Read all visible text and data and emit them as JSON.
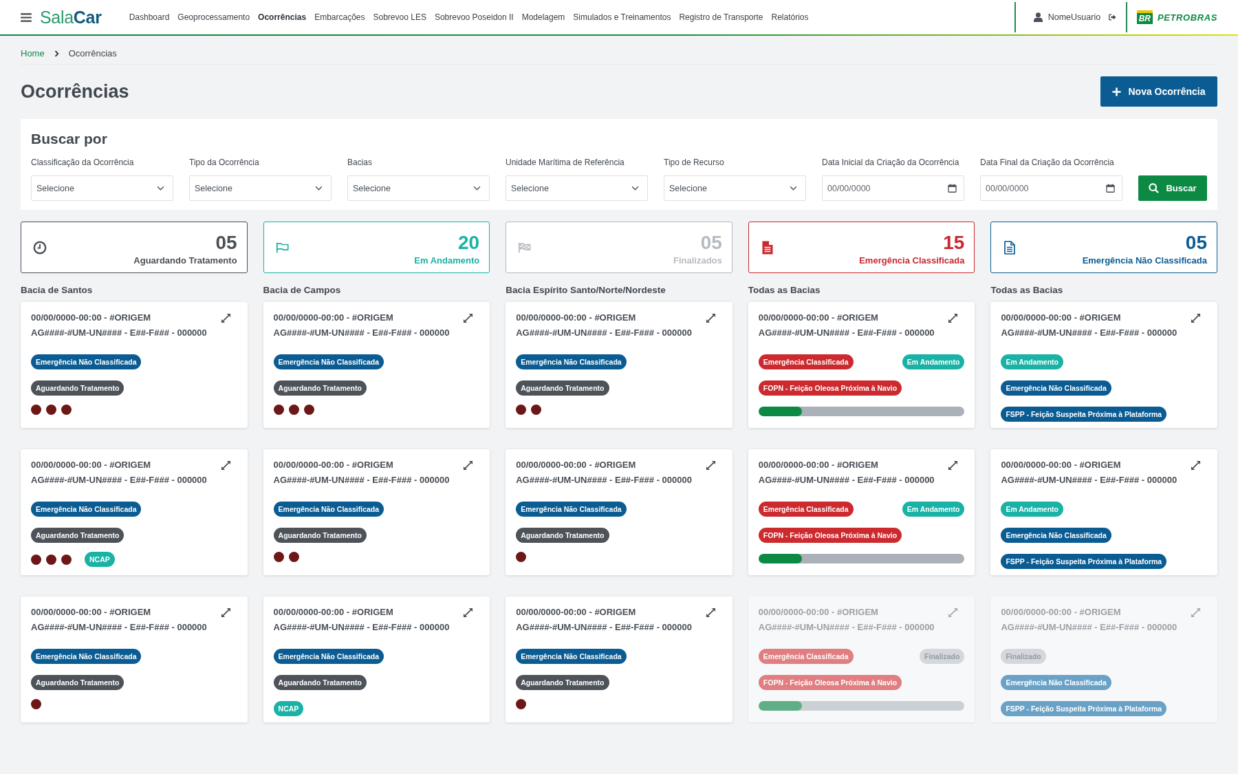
{
  "header": {
    "logo": "Sala**Car**",
    "nav": [
      {
        "label": "Dashboard",
        "selected": false
      },
      {
        "label": "Geoprocessamento",
        "selected": false
      },
      {
        "label": "Ocorrências",
        "selected": true
      },
      {
        "label": "Embarcações",
        "selected": false
      },
      {
        "label": "Sobrevoo LES",
        "selected": false
      },
      {
        "label": "Sobrevoo Poseidon II",
        "selected": false
      },
      {
        "label": "Modelagem",
        "selected": false
      },
      {
        "label": "Simulados e Treinamentos",
        "selected": false
      },
      {
        "label": "Registro de Transporte",
        "selected": false
      },
      {
        "label": "Relatórios",
        "selected": false
      }
    ],
    "user": "NomeUsuario",
    "brand": {
      "mark": "BR",
      "name": "PETROBRAS"
    }
  },
  "breadcrumb": {
    "home": "Home",
    "current": "Ocorrências"
  },
  "page": {
    "title": "Ocorrências",
    "new_button": "Nova Ocorrência"
  },
  "search": {
    "title": "Buscar por",
    "fields": [
      {
        "label": "Classificação da Ocorrência",
        "kind": "select",
        "value": "Selecione"
      },
      {
        "label": "Tipo da Ocorrência",
        "kind": "select",
        "value": "Selecione"
      },
      {
        "label": "Bacias",
        "kind": "select",
        "value": "Selecione"
      },
      {
        "label": "Unidade Marítima de Referência",
        "kind": "select",
        "value": "Selecione"
      },
      {
        "label": "Tipo de Recurso",
        "kind": "select",
        "value": "Selecione"
      },
      {
        "label": "Data Inicial da Criação da Ocorrência",
        "kind": "date",
        "placeholder": "00/00/0000"
      },
      {
        "label": "Data Final da Criação da Ocorrência",
        "kind": "date",
        "placeholder": "00/00/0000"
      }
    ],
    "button": "Buscar"
  },
  "stats": [
    {
      "kind": "waiting",
      "value": "05",
      "label": "Aguardando Tratamento",
      "color": "#4a5057"
    },
    {
      "kind": "ongoing",
      "value": "20",
      "label": "Em Andamento",
      "color": "#19b2a5"
    },
    {
      "kind": "finished",
      "value": "05",
      "label": "Finalizados",
      "color": "#b6bbc1"
    },
    {
      "kind": "classified",
      "value": "15",
      "label": "Emergência Classificada",
      "color": "#c8282e"
    },
    {
      "kind": "unclassified",
      "value": "05",
      "label": "Emergência Não Classificada",
      "color": "#0b5c93"
    }
  ],
  "columns": [
    {
      "title": "Bacia de Santos",
      "cards": [
        {
          "date": "00/00/0000-00:00 - #ORIGEM",
          "code": "AG####-#UM-UN#### - E##-F### - 000000",
          "disabled": false,
          "rows": [
            {
              "kind": "tags",
              "tags": [
                {
                  "label": "Emergência Não Classificada",
                  "color": "#0b5c93"
                }
              ]
            },
            {
              "kind": "tags",
              "tags": [
                {
                  "label": "Aguardando Tratamento",
                  "color": "#4d5359"
                }
              ]
            },
            {
              "kind": "dots",
              "dots": [
                {
                  "color": "#6e1717"
                },
                {
                  "color": "#6e1717"
                },
                {
                  "color": "#6e1717"
                }
              ]
            }
          ]
        },
        {
          "date": "00/00/0000-00:00 - #ORIGEM",
          "code": "AG####-#UM-UN#### - E##-F### - 000000",
          "disabled": false,
          "rows": [
            {
              "kind": "tags",
              "tags": [
                {
                  "label": "Emergência Não Classificada",
                  "color": "#0b5c93"
                }
              ]
            },
            {
              "kind": "tags",
              "tags": [
                {
                  "label": "Aguardando Tratamento",
                  "color": "#4d5359"
                }
              ]
            },
            {
              "kind": "dots",
              "dots": [
                {
                  "color": "#6e1717"
                },
                {
                  "color": "#6e1717"
                },
                {
                  "color": "#6e1717"
                }
              ],
              "tags": [
                {
                  "label": "NCAP",
                  "color": "#19b2a5"
                }
              ]
            }
          ]
        },
        {
          "date": "00/00/0000-00:00 - #ORIGEM",
          "code": "AG####-#UM-UN#### - E##-F### - 000000",
          "disabled": false,
          "rows": [
            {
              "kind": "tags",
              "tags": [
                {
                  "label": "Emergência Não Classificada",
                  "color": "#0b5c93"
                }
              ]
            },
            {
              "kind": "tags",
              "tags": [
                {
                  "label": "Aguardando Tratamento",
                  "color": "#4d5359"
                }
              ]
            },
            {
              "kind": "dots",
              "dots": [
                {
                  "color": "#6e1717"
                }
              ]
            }
          ]
        }
      ]
    },
    {
      "title": "Bacia de Campos",
      "cards": [
        {
          "date": "00/00/0000-00:00 - #ORIGEM",
          "code": "AG####-#UM-UN#### - E##-F### - 000000",
          "disabled": false,
          "rows": [
            {
              "kind": "tags",
              "tags": [
                {
                  "label": "Emergência Não Classificada",
                  "color": "#0b5c93"
                }
              ]
            },
            {
              "kind": "tags",
              "tags": [
                {
                  "label": "Aguardando Tratamento",
                  "color": "#4d5359"
                }
              ]
            },
            {
              "kind": "dots",
              "dots": [
                {
                  "color": "#6e1717"
                },
                {
                  "color": "#6e1717"
                },
                {
                  "color": "#6e1717"
                }
              ]
            }
          ]
        },
        {
          "date": "00/00/0000-00:00 - #ORIGEM",
          "code": "AG####-#UM-UN#### - E##-F### - 000000",
          "disabled": false,
          "rows": [
            {
              "kind": "tags",
              "tags": [
                {
                  "label": "Emergência Não Classificada",
                  "color": "#0b5c93"
                }
              ]
            },
            {
              "kind": "tags",
              "tags": [
                {
                  "label": "Aguardando Tratamento",
                  "color": "#4d5359"
                }
              ]
            },
            {
              "kind": "dots",
              "dots": [
                {
                  "color": "#6e1717"
                },
                {
                  "color": "#6e1717"
                }
              ]
            }
          ]
        },
        {
          "date": "00/00/0000-00:00 - #ORIGEM",
          "code": "AG####-#UM-UN#### - E##-F### - 000000",
          "disabled": false,
          "rows": [
            {
              "kind": "tags",
              "tags": [
                {
                  "label": "Emergência Não Classificada",
                  "color": "#0b5c93"
                }
              ]
            },
            {
              "kind": "tags",
              "tags": [
                {
                  "label": "Aguardando Tratamento",
                  "color": "#4d5359"
                }
              ]
            },
            {
              "kind": "tags",
              "tags": [
                {
                  "label": "NCAP",
                  "color": "#19b2a5"
                }
              ]
            }
          ]
        }
      ]
    },
    {
      "title": "Bacia Espírito Santo/Norte/Nordeste",
      "cards": [
        {
          "date": "00/00/0000-00:00 - #ORIGEM",
          "code": "AG####-#UM-UN#### - E##-F### - 000000",
          "disabled": false,
          "rows": [
            {
              "kind": "tags",
              "tags": [
                {
                  "label": "Emergência Não Classificada",
                  "color": "#0b5c93"
                }
              ]
            },
            {
              "kind": "tags",
              "tags": [
                {
                  "label": "Aguardando Tratamento",
                  "color": "#4d5359"
                }
              ]
            },
            {
              "kind": "dots",
              "dots": [
                {
                  "color": "#6e1717"
                },
                {
                  "color": "#6e1717"
                }
              ]
            }
          ]
        },
        {
          "date": "00/00/0000-00:00 - #ORIGEM",
          "code": "AG####-#UM-UN#### - E##-F### - 000000",
          "disabled": false,
          "rows": [
            {
              "kind": "tags",
              "tags": [
                {
                  "label": "Emergência Não Classificada",
                  "color": "#0b5c93"
                }
              ]
            },
            {
              "kind": "tags",
              "tags": [
                {
                  "label": "Aguardando Tratamento",
                  "color": "#4d5359"
                }
              ]
            },
            {
              "kind": "dots",
              "dots": [
                {
                  "color": "#6e1717"
                }
              ]
            }
          ]
        },
        {
          "date": "00/00/0000-00:00 - #ORIGEM",
          "code": "AG####-#UM-UN#### - E##-F### - 000000",
          "disabled": false,
          "rows": [
            {
              "kind": "tags",
              "tags": [
                {
                  "label": "Emergência Não Classificada",
                  "color": "#0b5c93"
                }
              ]
            },
            {
              "kind": "tags",
              "tags": [
                {
                  "label": "Aguardando Tratamento",
                  "color": "#4d5359"
                }
              ]
            },
            {
              "kind": "dots",
              "dots": [
                {
                  "color": "#6e1717"
                }
              ]
            }
          ]
        }
      ]
    },
    {
      "title": "Todas as Bacias",
      "cards": [
        {
          "date": "00/00/0000-00:00 - #ORIGEM",
          "code": "AG####-#UM-UN#### - E##-F### - 000000",
          "disabled": false,
          "rows": [
            {
              "kind": "tags",
              "tags": [
                {
                  "label": "Emergência Classificada",
                  "color": "#cc2a2f"
                },
                {
                  "label": "Em Andamento",
                  "color": "#19b2a5"
                }
              ]
            },
            {
              "kind": "tags",
              "tags": [
                {
                  "label": "FOPN - Feição Oleosa Próxima à Navio",
                  "color": "#cc2a2f"
                }
              ]
            },
            {
              "kind": "progress",
              "level": 0.21
            }
          ]
        },
        {
          "date": "00/00/0000-00:00 - #ORIGEM",
          "code": "AG####-#UM-UN#### - E##-F### - 000000",
          "disabled": false,
          "rows": [
            {
              "kind": "tags",
              "tags": [
                {
                  "label": "Emergência Classificada",
                  "color": "#cc2a2f"
                },
                {
                  "label": "Em Andamento",
                  "color": "#19b2a5"
                }
              ]
            },
            {
              "kind": "tags",
              "tags": [
                {
                  "label": "FOPN - Feição Oleosa Próxima à Navio",
                  "color": "#cc2a2f"
                }
              ]
            },
            {
              "kind": "progress",
              "level": 0.21
            }
          ]
        },
        {
          "date": "00/00/0000-00:00 - #ORIGEM",
          "code": "AG####-#UM-UN#### - E##-F### - 000000",
          "disabled": true,
          "rows": [
            {
              "kind": "tags",
              "tags": [
                {
                  "label": "Emergência Classificada",
                  "color": "#e07e81"
                },
                {
                  "label": "Finalizado",
                  "color": "#d4d7db"
                }
              ]
            },
            {
              "kind": "tags",
              "tags": [
                {
                  "label": "FOPN - Feição Oleosa Próxima à Navio",
                  "color": "#e07e81"
                }
              ]
            },
            {
              "kind": "progress",
              "level": 0.21
            }
          ]
        }
      ]
    },
    {
      "title": "Todas as Bacias",
      "cards": [
        {
          "date": "00/00/0000-00:00 - #ORIGEM",
          "code": "AG####-#UM-UN#### - E##-F### - 000000",
          "disabled": false,
          "rows": [
            {
              "kind": "tags",
              "tags": [
                {
                  "label": "Em Andamento",
                  "color": "#19b2a5"
                }
              ]
            },
            {
              "kind": "tags",
              "tags": [
                {
                  "label": "Emergência Não Classificada",
                  "color": "#0b5c93"
                }
              ]
            },
            {
              "kind": "tags",
              "tags": [
                {
                  "label": "FSPP - Feição Suspeita Próxima à Plataforma",
                  "color": "#0b5c93"
                }
              ]
            }
          ]
        },
        {
          "date": "00/00/0000-00:00 - #ORIGEM",
          "code": "AG####-#UM-UN#### - E##-F### - 000000",
          "disabled": false,
          "rows": [
            {
              "kind": "tags",
              "tags": [
                {
                  "label": "Em Andamento",
                  "color": "#19b2a5"
                }
              ]
            },
            {
              "kind": "tags",
              "tags": [
                {
                  "label": "Emergência Não Classificada",
                  "color": "#0b5c93"
                }
              ]
            },
            {
              "kind": "tags",
              "tags": [
                {
                  "label": "FSPP - Feição Suspeita Próxima à Plataforma",
                  "color": "#0b5c93"
                }
              ]
            }
          ]
        },
        {
          "date": "00/00/0000-00:00 - #ORIGEM",
          "code": "AG####-#UM-UN#### - E##-F### - 000000",
          "disabled": true,
          "rows": [
            {
              "kind": "tags",
              "tags": [
                {
                  "label": "Finalizado",
                  "color": "#d4d7db"
                }
              ]
            },
            {
              "kind": "tags",
              "tags": [
                {
                  "label": "Emergência Não Classificada",
                  "color": "#6aa2c7"
                }
              ]
            },
            {
              "kind": "tags",
              "tags": [
                {
                  "label": "FSPP - Feição Suspeita Próxima à Plataforma",
                  "color": "#6aa2c7"
                }
              ]
            }
          ]
        }
      ]
    }
  ]
}
